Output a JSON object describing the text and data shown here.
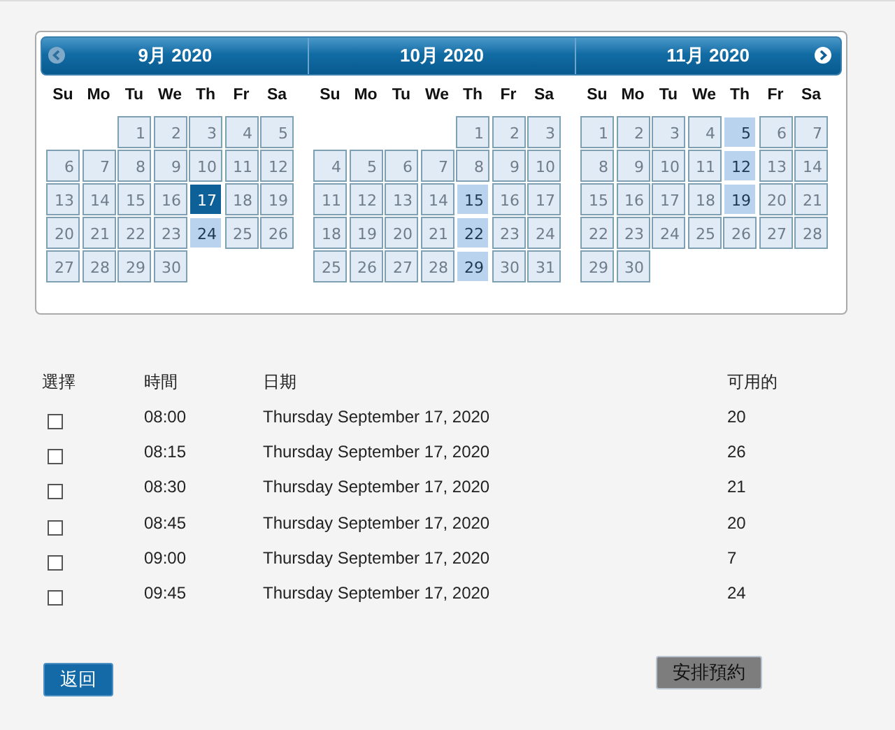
{
  "calendar": {
    "months": [
      {
        "title": "9月 2020",
        "weekdays": [
          "Su",
          "Mo",
          "Tu",
          "We",
          "Th",
          "Fr",
          "Sa"
        ],
        "weeks": [
          {
            "starts_mid_week": true,
            "days": [
              {
                "day": "1",
                "disabled": true,
                "selected": false
              },
              {
                "day": "2",
                "disabled": true,
                "selected": false
              },
              {
                "day": "3",
                "disabled": true,
                "selected": false
              },
              {
                "day": "4",
                "disabled": true,
                "selected": false
              },
              {
                "day": "5",
                "disabled": true,
                "selected": false
              }
            ]
          },
          {
            "days": [
              {
                "day": "6",
                "disabled": true,
                "selected": false
              },
              {
                "day": "7",
                "disabled": true,
                "selected": false
              },
              {
                "day": "8",
                "disabled": true,
                "selected": false
              },
              {
                "day": "9",
                "disabled": true,
                "selected": false
              },
              {
                "day": "10",
                "disabled": true,
                "selected": false
              },
              {
                "day": "11",
                "disabled": true,
                "selected": false
              },
              {
                "day": "12",
                "disabled": true,
                "selected": false
              }
            ]
          },
          {
            "days": [
              {
                "day": "13",
                "disabled": true,
                "selected": false
              },
              {
                "day": "14",
                "disabled": true,
                "selected": false
              },
              {
                "day": "15",
                "disabled": true,
                "selected": false
              },
              {
                "day": "16",
                "disabled": true,
                "selected": false
              },
              {
                "day": "17",
                "disabled": false,
                "selected": true
              },
              {
                "day": "18",
                "disabled": true,
                "selected": false
              },
              {
                "day": "19",
                "disabled": true,
                "selected": false
              }
            ]
          },
          {
            "days": [
              {
                "day": "20",
                "disabled": true,
                "selected": false
              },
              {
                "day": "21",
                "disabled": true,
                "selected": false
              },
              {
                "day": "22",
                "disabled": true,
                "selected": false
              },
              {
                "day": "23",
                "disabled": true,
                "selected": false
              },
              {
                "day": "24",
                "disabled": false,
                "selected": false
              },
              {
                "day": "25",
                "disabled": true,
                "selected": false
              },
              {
                "day": "26",
                "disabled": true,
                "selected": false
              }
            ]
          },
          {
            "days": [
              {
                "day": "27",
                "disabled": true,
                "selected": false
              },
              {
                "day": "28",
                "disabled": true,
                "selected": false
              },
              {
                "day": "29",
                "disabled": true,
                "selected": false
              },
              {
                "day": "30",
                "disabled": true,
                "selected": false
              }
            ]
          }
        ]
      },
      {
        "title": "10月 2020",
        "weekdays": [
          "Su",
          "Mo",
          "Tu",
          "We",
          "Th",
          "Fr",
          "Sa"
        ],
        "weeks": [
          {
            "starts_mid_week": true,
            "days": [
              {
                "day": "1",
                "disabled": true,
                "selected": false
              },
              {
                "day": "2",
                "disabled": true,
                "selected": false
              },
              {
                "day": "3",
                "disabled": true,
                "selected": false
              }
            ]
          },
          {
            "days": [
              {
                "day": "4",
                "disabled": true,
                "selected": false
              },
              {
                "day": "5",
                "disabled": true,
                "selected": false
              },
              {
                "day": "6",
                "disabled": true,
                "selected": false
              },
              {
                "day": "7",
                "disabled": true,
                "selected": false
              },
              {
                "day": "8",
                "disabled": true,
                "selected": false
              },
              {
                "day": "9",
                "disabled": true,
                "selected": false
              },
              {
                "day": "10",
                "disabled": true,
                "selected": false
              }
            ]
          },
          {
            "days": [
              {
                "day": "11",
                "disabled": true,
                "selected": false
              },
              {
                "day": "12",
                "disabled": true,
                "selected": false
              },
              {
                "day": "13",
                "disabled": true,
                "selected": false
              },
              {
                "day": "14",
                "disabled": true,
                "selected": false
              },
              {
                "day": "15",
                "disabled": false,
                "selected": false
              },
              {
                "day": "16",
                "disabled": true,
                "selected": false
              },
              {
                "day": "17",
                "disabled": true,
                "selected": false
              }
            ]
          },
          {
            "days": [
              {
                "day": "18",
                "disabled": true,
                "selected": false
              },
              {
                "day": "19",
                "disabled": true,
                "selected": false
              },
              {
                "day": "20",
                "disabled": true,
                "selected": false
              },
              {
                "day": "21",
                "disabled": true,
                "selected": false
              },
              {
                "day": "22",
                "disabled": false,
                "selected": false
              },
              {
                "day": "23",
                "disabled": true,
                "selected": false
              },
              {
                "day": "24",
                "disabled": true,
                "selected": false
              }
            ]
          },
          {
            "days": [
              {
                "day": "25",
                "disabled": true,
                "selected": false
              },
              {
                "day": "26",
                "disabled": true,
                "selected": false
              },
              {
                "day": "27",
                "disabled": true,
                "selected": false
              },
              {
                "day": "28",
                "disabled": true,
                "selected": false
              },
              {
                "day": "29",
                "disabled": false,
                "selected": false
              },
              {
                "day": "30",
                "disabled": true,
                "selected": false
              },
              {
                "day": "31",
                "disabled": true,
                "selected": false
              }
            ]
          }
        ]
      },
      {
        "title": "11月 2020",
        "weekdays": [
          "Su",
          "Mo",
          "Tu",
          "We",
          "Th",
          "Fr",
          "Sa"
        ],
        "weeks": [
          {
            "days": [
              {
                "day": "1",
                "disabled": true,
                "selected": false
              },
              {
                "day": "2",
                "disabled": true,
                "selected": false
              },
              {
                "day": "3",
                "disabled": true,
                "selected": false
              },
              {
                "day": "4",
                "disabled": true,
                "selected": false
              },
              {
                "day": "5",
                "disabled": false,
                "selected": false
              },
              {
                "day": "6",
                "disabled": true,
                "selected": false
              },
              {
                "day": "7",
                "disabled": true,
                "selected": false
              }
            ]
          },
          {
            "days": [
              {
                "day": "8",
                "disabled": true,
                "selected": false
              },
              {
                "day": "9",
                "disabled": true,
                "selected": false
              },
              {
                "day": "10",
                "disabled": true,
                "selected": false
              },
              {
                "day": "11",
                "disabled": true,
                "selected": false
              },
              {
                "day": "12",
                "disabled": false,
                "selected": false
              },
              {
                "day": "13",
                "disabled": true,
                "selected": false
              },
              {
                "day": "14",
                "disabled": true,
                "selected": false
              }
            ]
          },
          {
            "days": [
              {
                "day": "15",
                "disabled": true,
                "selected": false
              },
              {
                "day": "16",
                "disabled": true,
                "selected": false
              },
              {
                "day": "17",
                "disabled": true,
                "selected": false
              },
              {
                "day": "18",
                "disabled": true,
                "selected": false
              },
              {
                "day": "19",
                "disabled": false,
                "selected": false
              },
              {
                "day": "20",
                "disabled": true,
                "selected": false
              },
              {
                "day": "21",
                "disabled": true,
                "selected": false
              }
            ]
          },
          {
            "days": [
              {
                "day": "22",
                "disabled": true,
                "selected": false
              },
              {
                "day": "23",
                "disabled": true,
                "selected": false
              },
              {
                "day": "24",
                "disabled": true,
                "selected": false
              },
              {
                "day": "25",
                "disabled": true,
                "selected": false
              },
              {
                "day": "26",
                "disabled": true,
                "selected": false
              },
              {
                "day": "27",
                "disabled": true,
                "selected": false
              },
              {
                "day": "28",
                "disabled": true,
                "selected": false
              }
            ]
          },
          {
            "days": [
              {
                "day": "29",
                "disabled": true,
                "selected": false
              },
              {
                "day": "30",
                "disabled": true,
                "selected": false
              }
            ]
          }
        ]
      }
    ]
  },
  "table": {
    "columns": [
      "選擇",
      "時間",
      "日期",
      "可用的"
    ],
    "rows": [
      {
        "checked": false,
        "time": "08:00",
        "date": "Thursday September 17, 2020",
        "available": "20"
      },
      {
        "checked": false,
        "time": "08:15",
        "date": "Thursday September 17, 2020",
        "available": "26"
      },
      {
        "checked": false,
        "time": "08:30",
        "date": "Thursday September 17, 2020",
        "available": "21"
      },
      {
        "checked": false,
        "time": "08:45",
        "date": "Thursday September 17, 2020",
        "available": "20"
      },
      {
        "checked": false,
        "time": "09:00",
        "date": "Thursday September 17, 2020",
        "available": "7"
      },
      {
        "checked": false,
        "time": "09:45",
        "date": "Thursday September 17, 2020",
        "available": "24"
      }
    ]
  },
  "buttons": [
    {
      "label": "返回",
      "kind": "primary"
    },
    {
      "label": "安排預約",
      "kind": "secondary"
    }
  ]
}
